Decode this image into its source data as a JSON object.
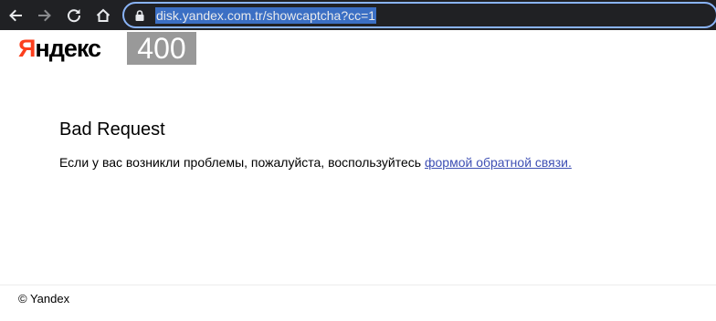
{
  "browser": {
    "url": "disk.yandex.com.tr/showcaptcha?cc=1",
    "icons": {
      "back": "arrow-left-icon",
      "forward": "arrow-right-icon",
      "reload": "reload-icon",
      "home": "home-icon",
      "lock": "lock-icon"
    }
  },
  "page": {
    "logo": {
      "first_letter": "Я",
      "rest": "ндекс"
    },
    "error_code": "400",
    "title": "Bad Request",
    "message": "Если у вас возникли проблемы, пожалуйста, воспользуйтесь ",
    "link_text": "формой обратной связи.",
    "footer": "© Yandex"
  },
  "colors": {
    "toolbar_bg": "#202124",
    "omnibox_border": "#8ab4f8",
    "logo_accent": "#fc3f1d",
    "badge_bg": "#999999",
    "link": "#3e4fb4"
  }
}
